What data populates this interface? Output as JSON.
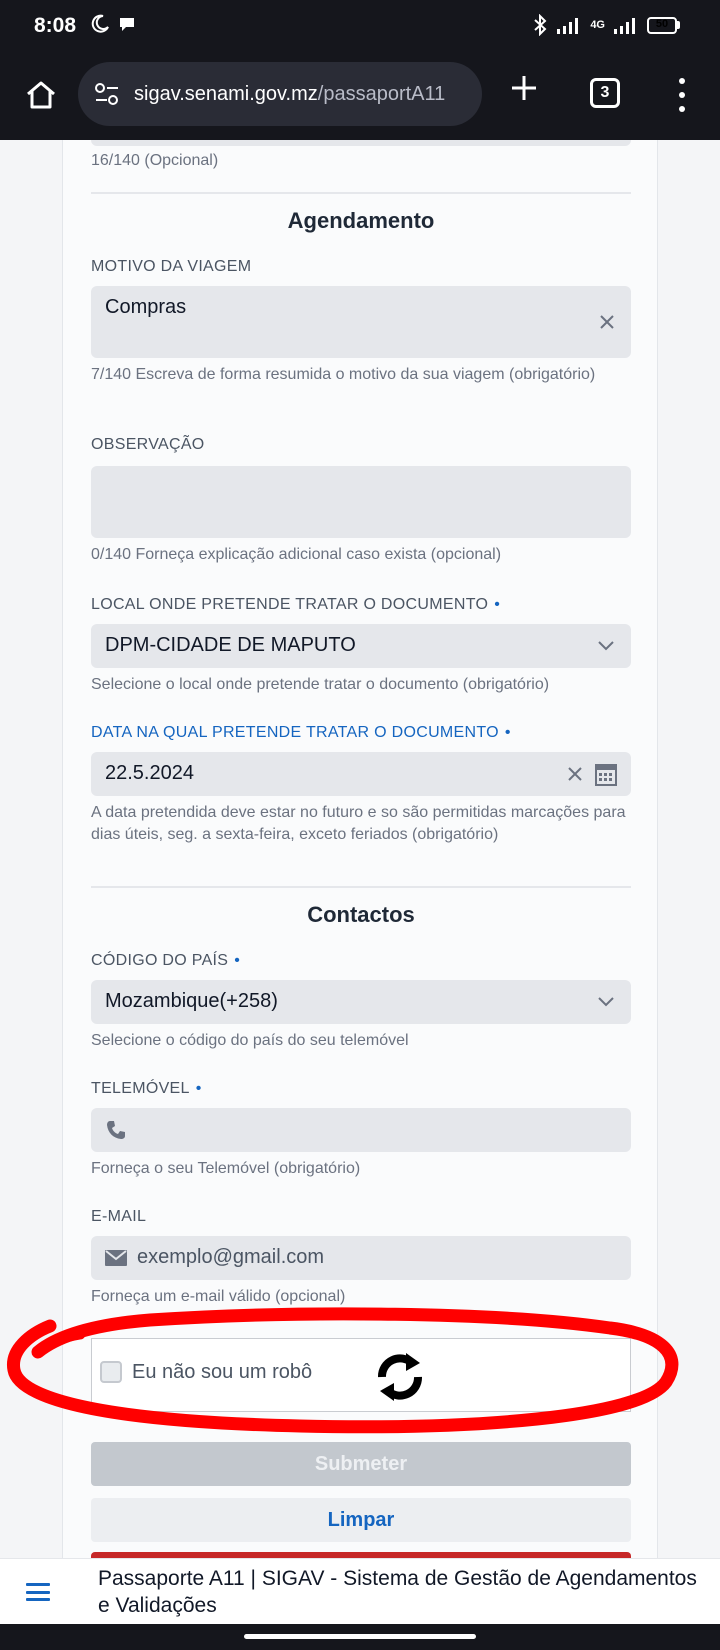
{
  "status_bar": {
    "time": "8:08",
    "network": "4G",
    "battery": "50"
  },
  "browser": {
    "url_domain": "sigav.senami.gov.mz",
    "url_path": "/passaportA11",
    "tab_count": "3"
  },
  "form": {
    "prev_field_hint": "16/140 (Opcional)",
    "section_agendamento": "Agendamento",
    "motivo": {
      "label": "MOTIVO DA VIAGEM",
      "value": "Compras",
      "hint": "7/140 Escreva de forma resumida o motivo da sua viagem (obrigatório)"
    },
    "observacao": {
      "label": "OBSERVAÇÃO",
      "value": "",
      "hint": "0/140 Forneça explicação adicional caso exista (opcional)"
    },
    "local": {
      "label": "LOCAL ONDE PRETENDE TRATAR O DOCUMENTO",
      "required_mark": "•",
      "value": "DPM-CIDADE DE MAPUTO",
      "hint": "Selecione o local onde pretende tratar o documento (obrigatório)"
    },
    "data": {
      "label": "DATA NA QUAL PRETENDE TRATAR O DOCUMENTO",
      "required_mark": "•",
      "value": "22.5.2024",
      "hint": "A data pretendida deve estar no futuro e so são permitidas marcações para dias úteis, seg. a sexta-feira, exceto feriados (obrigatório)"
    },
    "section_contactos": "Contactos",
    "codigo_pais": {
      "label": "CÓDIGO DO PAÍS",
      "required_mark": "•",
      "value": "Mozambique(+258)",
      "hint": "Selecione o código do país do seu telemóvel"
    },
    "telemovel": {
      "label": "TELEMÓVEL",
      "required_mark": "•",
      "value": "",
      "hint": "Forneça o seu Telemóvel (obrigatório)"
    },
    "email": {
      "label": "E-MAIL",
      "placeholder": "exemplo@gmail.com",
      "hint": "Forneça um e-mail válido (opcional)"
    },
    "captcha_label": "Eu não sou um robô",
    "submit_label": "Submeter",
    "clear_label": "Limpar"
  },
  "page_bar": {
    "title": "Passaporte A11 | SIGAV - Sistema de Gestão de Agendamentos e Validações"
  },
  "colors": {
    "accent": "#1565c0",
    "annotation": "#ff0000",
    "browser_chrome": "#15161c"
  }
}
